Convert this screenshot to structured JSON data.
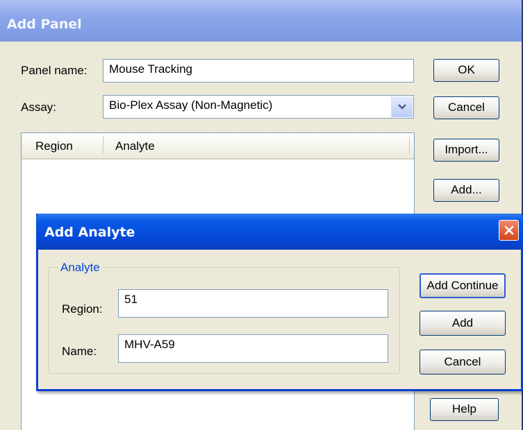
{
  "add_panel": {
    "title": "Add Panel",
    "panel_name_label": "Panel name:",
    "panel_name_value": "Mouse Tracking",
    "assay_label": "Assay:",
    "assay_value": "Bio-Plex Assay (Non-Magnetic)",
    "columns": [
      "Region",
      "Analyte"
    ],
    "buttons": {
      "ok": "OK",
      "cancel": "Cancel",
      "import": "Import...",
      "add": "Add...",
      "help": "Help"
    }
  },
  "add_analyte": {
    "title": "Add Analyte",
    "group_label": "Analyte",
    "region_label": "Region:",
    "region_value": "51",
    "name_label": "Name:",
    "name_value": "MHV-A59",
    "buttons": {
      "add_continue": "Add Continue",
      "add": "Add",
      "cancel": "Cancel"
    }
  },
  "icons": {
    "combo_arrow": "chevron-down-icon",
    "close": "close-icon"
  },
  "colors": {
    "dialog_title_bar": "#0548d6",
    "inactive_title_bar": "#8aa4e8",
    "close_button": "#d4451c",
    "group_label": "#0046d5"
  }
}
